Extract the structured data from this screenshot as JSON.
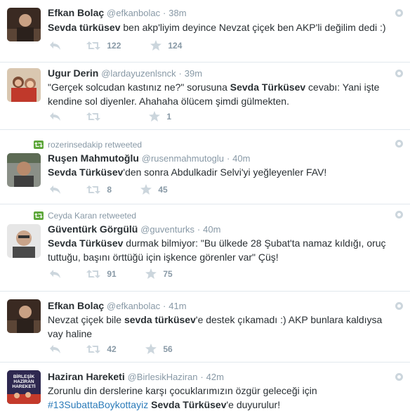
{
  "tweets": [
    {
      "fullname": "Efkan Bolaç",
      "username": "@efkanbolac",
      "time": "38m",
      "text_parts": [
        {
          "t": "Sevda türküsev",
          "b": true
        },
        {
          "t": " ben akp'liyim deyince Nevzat çiçek ben AKP'li değilim dedi :)"
        }
      ],
      "retweets": "122",
      "favorites": "124"
    },
    {
      "fullname": "Ugur Derin",
      "username": "@lardayuzenlsnck",
      "time": "39m",
      "text_parts": [
        {
          "t": "\"Gerçek solcudan kastınız ne?\" sorusuna "
        },
        {
          "t": "Sevda Türküsev",
          "b": true
        },
        {
          "t": " cevabı: Yani işte kendine sol diyenler. Ahahaha ölücem şimdi gülmekten."
        }
      ],
      "retweets": "",
      "favorites": "1"
    },
    {
      "retweeted_by": "rozerinsedakip retweeted",
      "fullname": "Ruşen Mahmutoğlu",
      "username": "@rusenmahmutoglu",
      "time": "40m",
      "text_parts": [
        {
          "t": "Sevda Türküsev",
          "b": true
        },
        {
          "t": "'den sonra Abdulkadir Selvi'yi yeğleyenler FAV!"
        }
      ],
      "retweets": "8",
      "favorites": "45"
    },
    {
      "retweeted_by": "Ceyda Karan retweeted",
      "fullname": "Güventürk Görgülü",
      "username": "@guventurks",
      "time": "40m",
      "text_parts": [
        {
          "t": "Sevda Türküsev",
          "b": true
        },
        {
          "t": " durmak bilmiyor: \"Bu ülkede 28 Şubat'ta namaz kıldığı, oruç tuttuğu, başını örttüğü için işkence görenler var\" Çüş!"
        }
      ],
      "retweets": "91",
      "favorites": "75"
    },
    {
      "fullname": "Efkan Bolaç",
      "username": "@efkanbolac",
      "time": "41m",
      "text_parts": [
        {
          "t": "Nevzat çiçek bile "
        },
        {
          "t": "sevda türküsev",
          "b": true
        },
        {
          "t": "'e destek çıkamadı :) AKP bunlara kaldıysa vay haline"
        }
      ],
      "retweets": "42",
      "favorites": "56"
    },
    {
      "fullname": "Haziran Hareketi",
      "username": "@BirlesikHaziran",
      "time": "42m",
      "text_parts": [
        {
          "t": "Zorunlu din derslerine karşı çocuklarımızın özgür geleceği için "
        },
        {
          "t": "#13SubattaBoykottayiz",
          "h": true
        },
        {
          "t": " "
        },
        {
          "t": "Sevda Türküsev",
          "b": true
        },
        {
          "t": "'e duyurulur!"
        }
      ],
      "avatar_text": [
        "BİRLEŞİK",
        "HAZİRAN",
        "HAREKETİ"
      ],
      "retweets": "",
      "favorites": ""
    }
  ],
  "colors": {
    "text": "#292f33",
    "muted": "#8899a6",
    "divider": "#e1e8ed",
    "retweet_badge": "#5ea73b",
    "hashtag": "#2b7bb9"
  },
  "icons": [
    "reply-icon",
    "retweet-icon",
    "favorite-icon",
    "more-options-icon",
    "retweeted-badge-icon"
  ]
}
